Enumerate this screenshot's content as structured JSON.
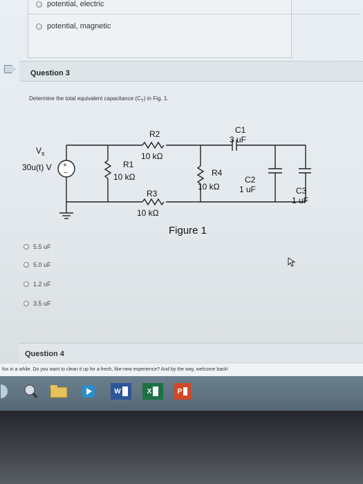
{
  "top_options": [
    {
      "label": "potential, electric"
    },
    {
      "label": "potential, magnetic"
    }
  ],
  "question3": {
    "title": "Question 3",
    "text": "Determine the total equivalent capacitance (C",
    "text_sub": "T",
    "text_end": ") in Fig. 1."
  },
  "figure": {
    "source_label": "V",
    "source_label_sub": "s",
    "source_value": "30u(t) V",
    "r1": "R1",
    "r1_value": "10 kΩ",
    "r2": "R2",
    "r2_value": "10 kΩ",
    "r3": "R3",
    "r3_value": "10 kΩ",
    "r4": "R4",
    "r4_value": "10 kΩ",
    "c1": "C1",
    "c1_value": "3 uF",
    "c2": "C2",
    "c2_value": "1 uF",
    "c3": "C3",
    "c3_value": "1 uF",
    "caption": "Figure 1"
  },
  "answers": [
    {
      "label": "5.5 uF"
    },
    {
      "label": "5.0 uF"
    },
    {
      "label": "1.2 uF"
    },
    {
      "label": "3.5 uF"
    }
  ],
  "question4": {
    "title": "Question 4"
  },
  "notice": "fox in a while. Do you want to clean it up for a fresh, like-new experience? And by the way, welcome back!",
  "taskbar": {
    "word_label": "W",
    "excel_label": "X",
    "ppt_label": "P"
  },
  "colors": {
    "word": "#2b579a",
    "excel": "#1e7145",
    "powerpoint": "#d24726",
    "taskbar": "#5f7280"
  }
}
